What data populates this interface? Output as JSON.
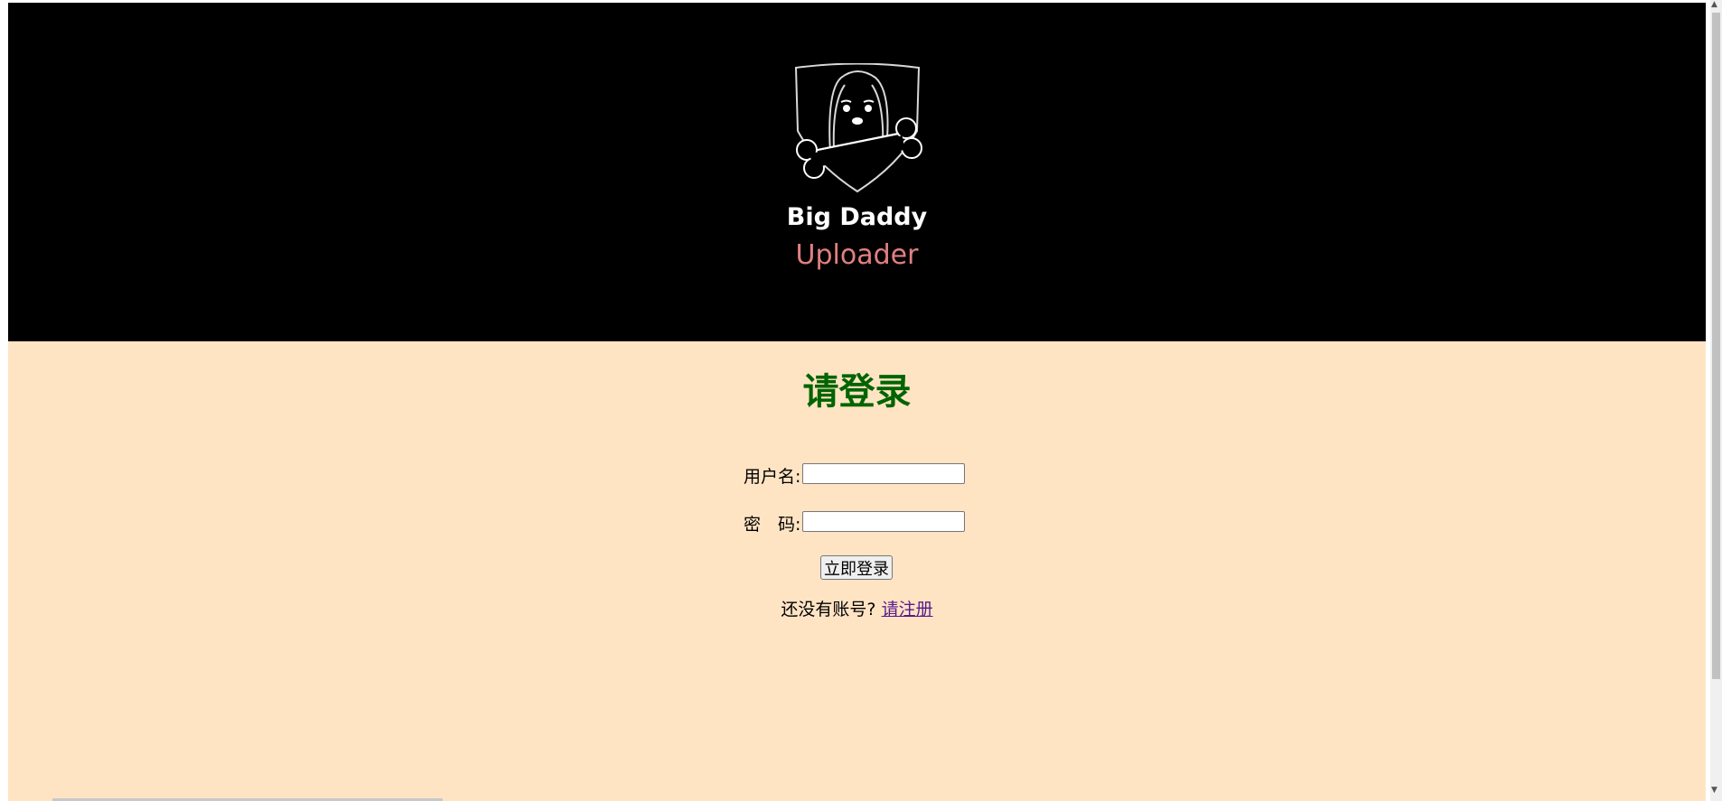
{
  "header": {
    "brand_name": "Big Daddy",
    "brand_sub": "Uploader",
    "logo_icon": "dog-with-bone-shield-icon",
    "background_color": "#000000",
    "sub_color": "#e08080"
  },
  "login": {
    "title": "请登录",
    "title_color": "#006400",
    "username_label": "用户名:",
    "username_value": "",
    "password_label": "密　码:",
    "password_value": "",
    "submit_label": "立即登录",
    "no_account_text": "还没有账号?",
    "register_link": "请注册",
    "background_color": "#ffe4c4"
  }
}
